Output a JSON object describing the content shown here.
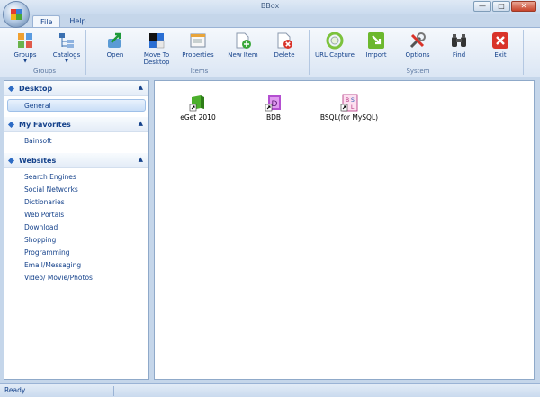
{
  "window": {
    "title": "BBox"
  },
  "tabs": [
    {
      "label": "File",
      "active": true
    },
    {
      "label": "Help",
      "active": false
    }
  ],
  "ribbon": {
    "groups": [
      {
        "label": "Groups",
        "buttons": [
          {
            "label": "Groups",
            "icon": "groups-icon",
            "dropdown": true
          },
          {
            "label": "Catalogs",
            "icon": "catalogs-icon",
            "dropdown": true
          }
        ]
      },
      {
        "label": "Items",
        "buttons": [
          {
            "label": "Open",
            "icon": "open-arrow-icon"
          },
          {
            "label": "Move To Desktop",
            "icon": "move-to-desktop-icon"
          },
          {
            "label": "Properties",
            "icon": "properties-icon"
          },
          {
            "label": "New Item",
            "icon": "new-item-icon"
          },
          {
            "label": "Delete",
            "icon": "delete-icon"
          }
        ]
      },
      {
        "label": "System",
        "buttons": [
          {
            "label": "URL Capture",
            "icon": "url-capture-icon"
          },
          {
            "label": "Import",
            "icon": "import-icon"
          },
          {
            "label": "Options",
            "icon": "options-tools-icon"
          },
          {
            "label": "Find",
            "icon": "binoculars-icon"
          },
          {
            "label": "Exit",
            "icon": "exit-icon"
          }
        ]
      }
    ]
  },
  "sidebar": {
    "sections": [
      {
        "title": "Desktop",
        "items": [
          {
            "label": "General",
            "selected": true
          }
        ]
      },
      {
        "title": "My Favorites",
        "items": [
          {
            "label": "Bainsoft",
            "selected": false
          }
        ]
      },
      {
        "title": "Websites",
        "items": [
          {
            "label": "Search Engines"
          },
          {
            "label": "Social Networks"
          },
          {
            "label": "Dictionaries"
          },
          {
            "label": "Web Portals"
          },
          {
            "label": "Download"
          },
          {
            "label": "Shopping"
          },
          {
            "label": "Programming"
          },
          {
            "label": "Email/Messaging"
          },
          {
            "label": "Video/ Movie/Photos"
          }
        ]
      }
    ]
  },
  "desktop_items": [
    {
      "label": "eGet 2010",
      "icon": "eget-shortcut-icon"
    },
    {
      "label": "BDB",
      "icon": "bdb-shortcut-icon"
    },
    {
      "label": "BSQL(for MySQL)",
      "icon": "bsql-shortcut-icon"
    }
  ],
  "statusbar": {
    "text": "Ready"
  },
  "colors": {
    "ribbon_text": "#15428b",
    "frame": "#c5d6ea",
    "exit_red": "#d9332a",
    "import_green": "#6cb82e"
  }
}
